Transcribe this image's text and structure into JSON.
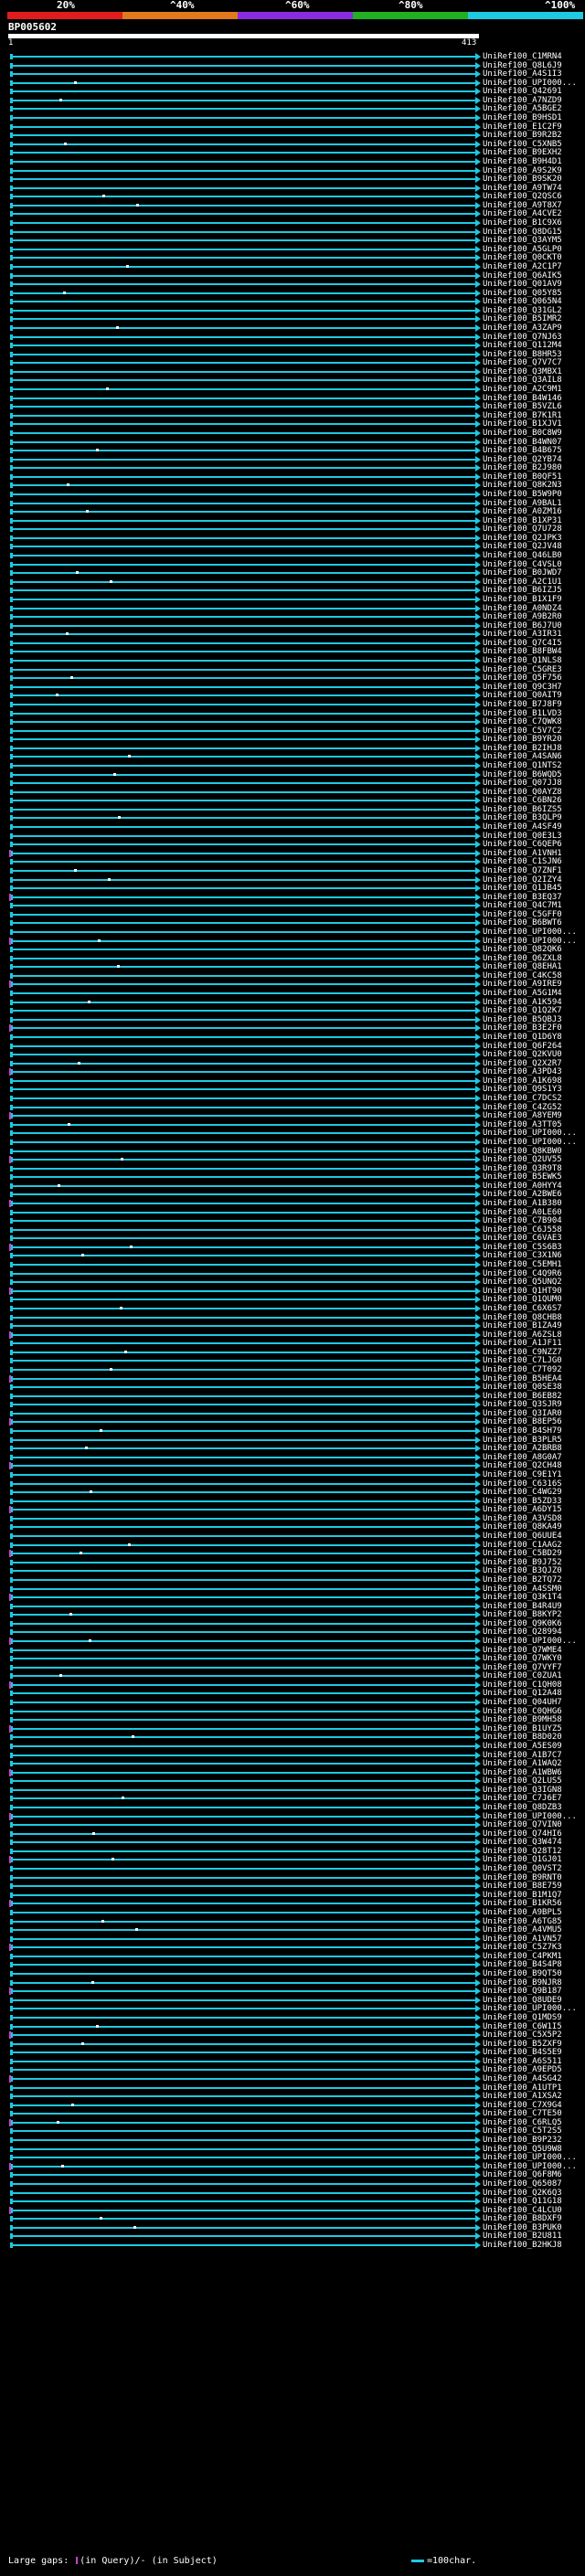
{
  "scale": {
    "labels": [
      "20%",
      "^40%",
      "^60%",
      "^80%",
      "^100%"
    ],
    "colors": [
      "#e01c1c",
      "#e07a1c",
      "#8a2be2",
      "#22b022",
      "#1ec9e2"
    ]
  },
  "query": {
    "id": "BP005602",
    "start": "1",
    "end": "413"
  },
  "hits": [
    "UniRef100_C1MRN4",
    "UniRef100_Q8L6J9",
    "UniRef100_A4S1I3",
    "UniRef100_UPI000...",
    "UniRef100_Q42691",
    "UniRef100_A7NZD9",
    "UniRef100_A5BGE2",
    "UniRef100_B9HSD1",
    "UniRef100_E1C2F9",
    "UniRef100_B9R2B2",
    "UniRef100_C5XNB5",
    "UniRef100_B9EXH2",
    "UniRef100_B9H4D1",
    "UniRef100_A9S2K9",
    "UniRef100_B9SK20",
    "UniRef100_A9TW74",
    "UniRef100_Q2QSC6",
    "UniRef100_A9T8X7",
    "UniRef100_A4CVE2",
    "UniRef100_B1C9X6",
    "UniRef100_Q8DG15",
    "UniRef100_Q3AYM5",
    "UniRef100_A5GLP0",
    "UniRef100_Q0CKT0",
    "UniRef100_A2C1P7",
    "UniRef100_Q6AIK5",
    "UniRef100_Q01AV9",
    "UniRef100_Q05Y85",
    "UniRef100_Q065N4",
    "UniRef100_Q31GL2",
    "UniRef100_B5IMR2",
    "UniRef100_A3ZAP9",
    "UniRef100_Q7NJ63",
    "UniRef100_Q112M4",
    "UniRef100_B8HR53",
    "UniRef100_Q7V7C7",
    "UniRef100_Q3MBX1",
    "UniRef100_Q3AIL8",
    "UniRef100_A2C9M1",
    "UniRef100_B4W146",
    "UniRef100_B5VZL6",
    "UniRef100_B7K1R1",
    "UniRef100_B1XJV1",
    "UniRef100_B0C8W9",
    "UniRef100_B4WN07",
    "UniRef100_B4B675",
    "UniRef100_Q2YB74",
    "UniRef100_B2J980",
    "UniRef100_B0QF51",
    "UniRef100_Q8K2N3",
    "UniRef100_B5W9P0",
    "UniRef100_A9BAL1",
    "UniRef100_A0ZM16",
    "UniRef100_B1XP31",
    "UniRef100_Q7U728",
    "UniRef100_Q2JPK3",
    "UniRef100_Q2JV48",
    "UniRef100_Q46LB0",
    "UniRef100_C4VSL0",
    "UniRef100_B0JWD7",
    "UniRef100_A2C1U1",
    "UniRef100_B6IZJ5",
    "UniRef100_B1X1F9",
    "UniRef100_A0NDZ4",
    "UniRef100_A9B2R0",
    "UniRef100_B6J7U0",
    "UniRef100_A3IR31",
    "UniRef100_Q7C4I5",
    "UniRef100_B8FBW4",
    "UniRef100_Q1NLS8",
    "UniRef100_C5GRE3",
    "UniRef100_Q5F756",
    "UniRef100_Q9C3H7",
    "UniRef100_Q0AIT9",
    "UniRef100_B7J8F9",
    "UniRef100_B1LVD3",
    "UniRef100_C7QWK8",
    "UniRef100_C5V7C2",
    "UniRef100_B9YR20",
    "UniRef100_B2IHJ8",
    "UniRef100_A4SAN6",
    "UniRef100_Q1NTS2",
    "UniRef100_B6WQD5",
    "UniRef100_Q07JJ8",
    "UniRef100_Q0AYZ8",
    "UniRef100_C6BN26",
    "UniRef100_B6IZS5",
    "UniRef100_B3QLP9",
    "UniRef100_A4SF49",
    "UniRef100_Q0E3L3",
    "UniRef100_C6QEP6",
    "UniRef100_A1VNH1",
    "UniRef100_C1SJN6",
    "UniRef100_Q7ZNF1",
    "UniRef100_Q2IZY4",
    "UniRef100_Q1JB45",
    "UniRef100_B3EQ37",
    "UniRef100_Q4C7M1",
    "UniRef100_C5GFF0",
    "UniRef100_B6BWT6",
    "UniRef100_UPI000...",
    "UniRef100_UPI000...",
    "UniRef100_Q82QK6",
    "UniRef100_Q6ZXL8",
    "UniRef100_Q8EHA1",
    "UniRef100_C4KC58",
    "UniRef100_A9IRE9",
    "UniRef100_A5G1M4",
    "UniRef100_A1K594",
    "UniRef100_Q1Q2K7",
    "UniRef100_B5QBJ3",
    "UniRef100_B3E2F0",
    "UniRef100_Q1D6Y8",
    "UniRef100_Q6F264",
    "UniRef100_Q2KVU0",
    "UniRef100_Q2X2R7",
    "UniRef100_A3PD43",
    "UniRef100_A1K698",
    "UniRef100_Q9S1Y3",
    "UniRef100_C7DCS2",
    "UniRef100_C4ZG52",
    "UniRef100_A8YEM9",
    "UniRef100_A3TT05",
    "UniRef100_UPI000...",
    "UniRef100_UPI000...",
    "UniRef100_Q8KBW0",
    "UniRef100_Q2UV55",
    "UniRef100_Q3R9T8",
    "UniRef100_B5EWK5",
    "UniRef100_A0HYY4",
    "UniRef100_A2BWE6",
    "UniRef100_A1B380",
    "UniRef100_A0LE60",
    "UniRef100_C7B904",
    "UniRef100_C6J558",
    "UniRef100_C6VAE3",
    "UniRef100_C5S6B3",
    "UniRef100_C3X1N6",
    "UniRef100_C5EMH1",
    "UniRef100_C4Q9R6",
    "UniRef100_Q5UNQ2",
    "UniRef100_Q1HT90",
    "UniRef100_Q1QUM0",
    "UniRef100_C6X6S7",
    "UniRef100_Q8CHB8",
    "UniRef100_B1ZA49",
    "UniRef100_A6ZSL8",
    "UniRef100_A1JF11",
    "UniRef100_C9NZZ7",
    "UniRef100_C7LJG0",
    "UniRef100_C7T092",
    "UniRef100_B5HEA4",
    "UniRef100_Q0SE38",
    "UniRef100_B6EB82",
    "UniRef100_Q3SJR9",
    "UniRef100_Q3IAR0",
    "UniRef100_B8EP56",
    "UniRef100_B4SH79",
    "UniRef100_B3PLR5",
    "UniRef100_A2BRB8",
    "UniRef100_A8G0A7",
    "UniRef100_Q2CH48",
    "UniRef100_C9E1Y1",
    "UniRef100_C6316S",
    "UniRef100_C4WG29",
    "UniRef100_B5ZD33",
    "UniRef100_A6DY15",
    "UniRef100_A3VSD8",
    "UniRef100_Q8KA49",
    "UniRef100_Q6UUE4",
    "UniRef100_C1AAG2",
    "UniRef100_C5BD29",
    "UniRef100_B9J752",
    "UniRef100_B3QJZ0",
    "UniRef100_B2TQ72",
    "UniRef100_A4SSM0",
    "UniRef100_Q3K1T4",
    "UniRef100_B4R4U9",
    "UniRef100_B8KYP2",
    "UniRef100_Q9K0K6",
    "UniRef100_Q28994",
    "UniRef100_UPI000...",
    "UniRef100_Q7WME4",
    "UniRef100_Q7WKY0",
    "UniRef100_Q7VYF7",
    "UniRef100_C0ZUA1",
    "UniRef100_C1QH08",
    "UniRef100_Q12A48",
    "UniRef100_Q04UH7",
    "UniRef100_C0QHG6",
    "UniRef100_B9MH58",
    "UniRef100_B1UYZ5",
    "UniRef100_B8D020",
    "UniRef100_A5ES09",
    "UniRef100_A1B7C7",
    "UniRef100_A1WAQ2",
    "UniRef100_A1WBW6",
    "UniRef100_Q2LUS5",
    "UniRef100_Q3IGN8",
    "UniRef100_C7J6E7",
    "UniRef100_Q8DZB3",
    "UniRef100_UPI000...",
    "UniRef100_Q7VIN0",
    "UniRef100_Q74HI6",
    "UniRef100_Q3W474",
    "UniRef100_Q28T12",
    "UniRef100_Q1GJ01",
    "UniRef100_Q0VST2",
    "UniRef100_B9RNT0",
    "UniRef100_B8E759",
    "UniRef100_B1M1Q7",
    "UniRef100_B1KR56",
    "UniRef100_A9BPL5",
    "UniRef100_A6TG85",
    "UniRef100_A4VMU5",
    "UniRef100_A1VN57",
    "UniRef100_C5Z7K3",
    "UniRef100_C4PKM1",
    "UniRef100_B4S4P8",
    "UniRef100_B9QT50",
    "UniRef100_B9NJR8",
    "UniRef100_Q9B187",
    "UniRef100_Q8UDE9",
    "UniRef100_UPI000...",
    "UniRef100_Q1MDS9",
    "UniRef100_C6W1I5",
    "UniRef100_C5X5P2",
    "UniRef100_B5ZXF9",
    "UniRef100_B4S5E9",
    "UniRef100_A6S511",
    "UniRef100_A9EPD5",
    "UniRef100_A4SG42",
    "UniRef100_A1UTP1",
    "UniRef100_A1XSA2",
    "UniRef100_C7X9G4",
    "UniRef100_C7TE50",
    "UniRef100_C6RLQ5",
    "UniRef100_C5T2S5",
    "UniRef100_B9P232",
    "UniRef100_Q5U9W8",
    "UniRef100_UPI000...",
    "UniRef100_UPI000...",
    "UniRef100_Q6F8M6",
    "UniRef100_Q65087",
    "UniRef100_Q2K6Q3",
    "UniRef100_Q11G18",
    "UniRef100_C4LCU0",
    "UniRef100_B8DXF9",
    "UniRef100_B3PUK0",
    "UniRef100_B2U811",
    "UniRef100_B2HKJ8"
  ],
  "legend": {
    "left_prefix": "Large gaps:",
    "left_query": "(in Query)",
    "left_sep": "/-",
    "left_subject": "(in Subject)",
    "right": "=100char."
  }
}
